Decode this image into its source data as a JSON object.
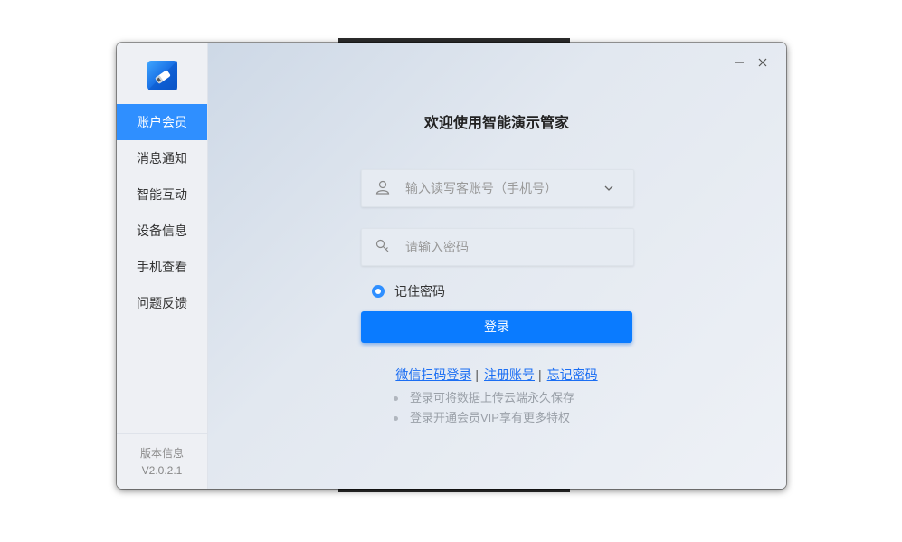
{
  "app": {
    "title": "欢迎使用智能演示管家",
    "brand_color": "#2f8fff"
  },
  "sidebar": {
    "items": [
      {
        "label": "账户会员",
        "active": true
      },
      {
        "label": "消息通知",
        "active": false
      },
      {
        "label": "智能互动",
        "active": false
      },
      {
        "label": "设备信息",
        "active": false
      },
      {
        "label": "手机查看",
        "active": false
      },
      {
        "label": "问题反馈",
        "active": false
      }
    ],
    "version_label": "版本信息",
    "version": "V2.0.2.1"
  },
  "window_controls": {
    "minimize_icon": "minimize-icon",
    "close_icon": "close-icon"
  },
  "form": {
    "account": {
      "placeholder": "输入读写客账号（手机号）",
      "value": "",
      "icon": "user-icon"
    },
    "password": {
      "placeholder": "请输入密码",
      "value": "",
      "icon": "key-icon"
    },
    "remember": {
      "label": "记住密码",
      "checked": true
    },
    "login_label": "登录"
  },
  "links": {
    "wechat": "微信扫码登录",
    "register": "注册账号",
    "forgot": "忘记密码",
    "separator": "|"
  },
  "tips": [
    "登录可将数据上传云端永久保存",
    "登录开通会员VIP享有更多特权"
  ]
}
